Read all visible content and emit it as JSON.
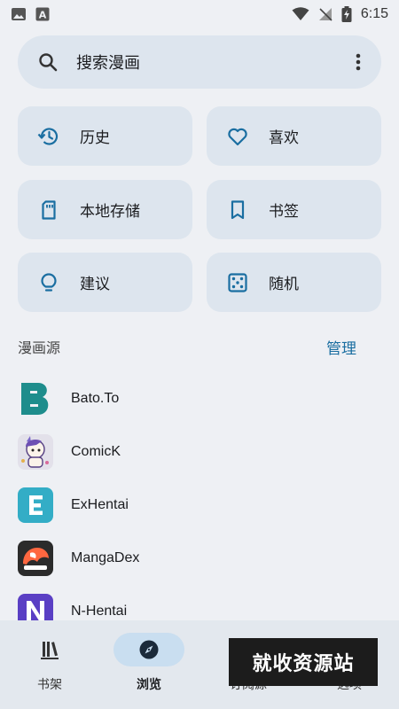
{
  "status_bar": {
    "time": "6:15"
  },
  "search": {
    "placeholder": "搜索漫画"
  },
  "shortcuts": {
    "history": "历史",
    "favorites": "喜欢",
    "local_storage": "本地存储",
    "bookmarks": "书签",
    "suggestions": "建议",
    "random": "随机"
  },
  "sources_section": {
    "title": "漫画源",
    "manage": "管理"
  },
  "sources": [
    {
      "name": "Bato.To"
    },
    {
      "name": "ComicK"
    },
    {
      "name": "ExHentai"
    },
    {
      "name": "MangaDex"
    },
    {
      "name": "N-Hentai"
    }
  ],
  "bottom_nav": {
    "shelf": "书架",
    "browse": "浏览",
    "subscriptions": "订阅源",
    "options": "选项"
  },
  "watermark": {
    "text": "就收资源站"
  },
  "colors": {
    "accent": "#1a6ea1",
    "tile_bg": "#dde5ee",
    "page_bg": "#eef0f4",
    "nav_active": "#c9def0"
  }
}
